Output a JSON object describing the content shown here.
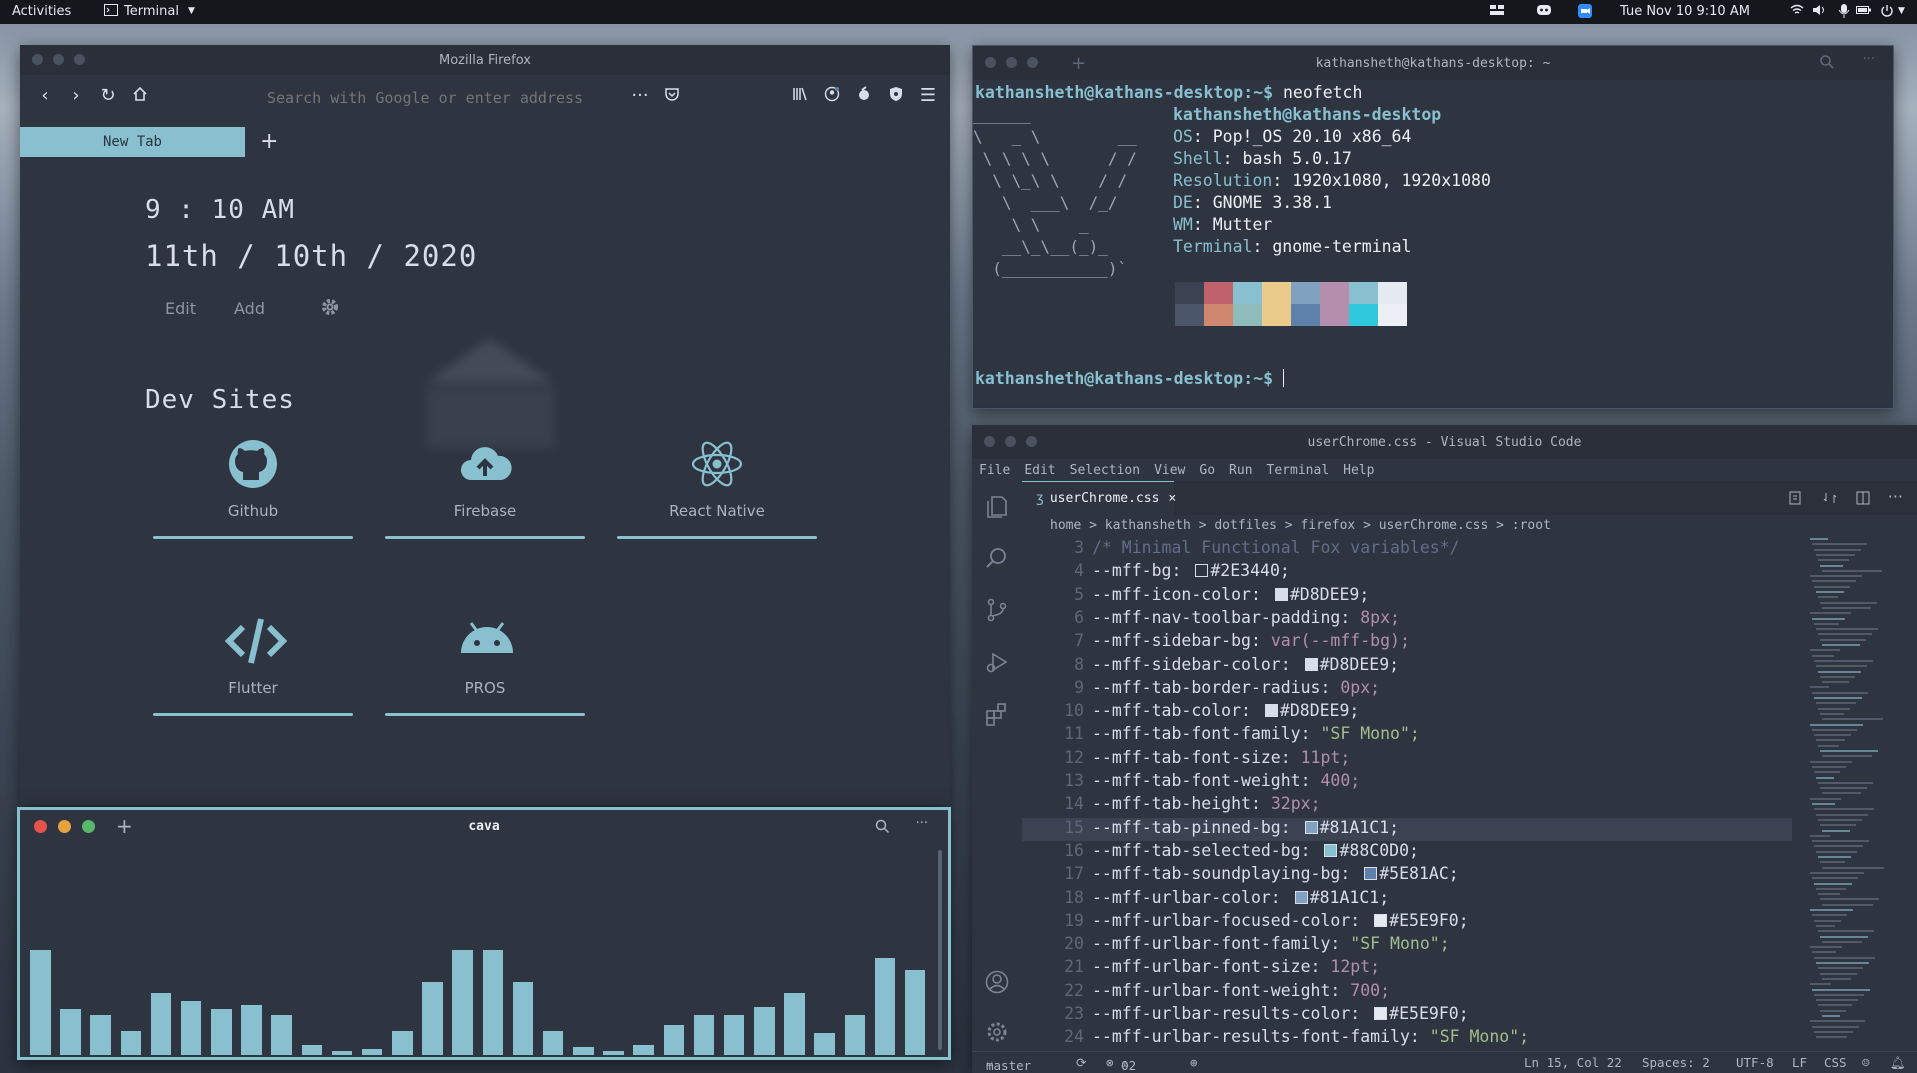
{
  "topbar": {
    "activities": "Activities",
    "app_menu": "Terminal",
    "clock": "Tue Nov 10  9:10 AM"
  },
  "firefox": {
    "title": "Mozilla Firefox",
    "url_placeholder": "Search with Google or enter address",
    "tab_label": "New Tab",
    "time_hour": "9",
    "time_rest": "10 AM",
    "date_parts": [
      "11th",
      "10th",
      "2020"
    ],
    "edit_label": "Edit",
    "add_label": "Add",
    "section_title": "Dev Sites",
    "sites": [
      {
        "label": "Github",
        "icon": "github-icon"
      },
      {
        "label": "Firebase",
        "icon": "cloud-upload-icon"
      },
      {
        "label": "React Native",
        "icon": "react-icon"
      },
      {
        "label": "Flutter",
        "icon": "code-icon"
      },
      {
        "label": "PROS",
        "icon": "android-icon"
      }
    ]
  },
  "terminal": {
    "title": "kathansheth@kathans-desktop: ~",
    "prompt": "kathansheth@kathans-desktop:~$",
    "command": "neofetch",
    "user_host": "kathansheth@kathans-desktop",
    "info": [
      {
        "key": "OS",
        "value": "Pop!_OS 20.10 x86_64"
      },
      {
        "key": "Shell",
        "value": "bash 5.0.17"
      },
      {
        "key": "Resolution",
        "value": "1920x1080, 1920x1080"
      },
      {
        "key": "DE",
        "value": "GNOME 3.38.1"
      },
      {
        "key": "WM",
        "value": "Mutter"
      },
      {
        "key": "Terminal",
        "value": "gnome-terminal"
      }
    ],
    "palette_top": [
      "#3B4252",
      "#BF616A",
      "#88C0D0",
      "#EBCB8B",
      "#81A1C1",
      "#B48EAD",
      "#88C0D0",
      "#E5E9F0"
    ],
    "palette_bottom": [
      "#4C566A",
      "#D08770",
      "#8FBCBB",
      "#EBCB8B",
      "#5E81AC",
      "#B48EAD",
      "#30C8DC",
      "#ECEFF4"
    ]
  },
  "vscode": {
    "title": "userChrome.css - Visual Studio Code",
    "menu": [
      "File",
      "Edit",
      "Selection",
      "View",
      "Go",
      "Run",
      "Terminal",
      "Help"
    ],
    "tab_label": "userChrome.css",
    "breadcrumb": "home > kathansheth > dotfiles > firefox > userChrome.css > :root",
    "lines": [
      {
        "n": "3",
        "prop": "/* Minimal Functional Fox variables*/",
        "kind": "comment"
      },
      {
        "n": "4",
        "prop": "--mff-bg:",
        "val": "#2E3440;",
        "kind": "color",
        "swatch": "#2E3440"
      },
      {
        "n": "5",
        "prop": "--mff-icon-color:",
        "val": "#D8DEE9;",
        "kind": "color",
        "swatch": "#D8DEE9"
      },
      {
        "n": "6",
        "prop": "--mff-nav-toolbar-padding:",
        "val": "8px;",
        "kind": "num"
      },
      {
        "n": "7",
        "prop": "--mff-sidebar-bg:",
        "val": "var(--mff-bg);",
        "kind": "var"
      },
      {
        "n": "8",
        "prop": "--mff-sidebar-color:",
        "val": "#D8DEE9;",
        "kind": "color",
        "swatch": "#D8DEE9"
      },
      {
        "n": "9",
        "prop": "--mff-tab-border-radius:",
        "val": "0px;",
        "kind": "num"
      },
      {
        "n": "10",
        "prop": "--mff-tab-color:",
        "val": "#D8DEE9;",
        "kind": "color",
        "swatch": "#D8DEE9"
      },
      {
        "n": "11",
        "prop": "--mff-tab-font-family:",
        "val": "\"SF Mono\";",
        "kind": "str"
      },
      {
        "n": "12",
        "prop": "--mff-tab-font-size:",
        "val": "11pt;",
        "kind": "num"
      },
      {
        "n": "13",
        "prop": "--mff-tab-font-weight:",
        "val": "400;",
        "kind": "num"
      },
      {
        "n": "14",
        "prop": "--mff-tab-height:",
        "val": "32px;",
        "kind": "num"
      },
      {
        "n": "15",
        "prop": "--mff-tab-pinned-bg:",
        "val": "#81A1C1;",
        "kind": "color",
        "swatch": "#81A1C1"
      },
      {
        "n": "16",
        "prop": "--mff-tab-selected-bg:",
        "val": "#88C0D0;",
        "kind": "color",
        "swatch": "#88C0D0"
      },
      {
        "n": "17",
        "prop": "--mff-tab-soundplaying-bg:",
        "val": "#5E81AC;",
        "kind": "color",
        "swatch": "#5E81AC"
      },
      {
        "n": "18",
        "prop": "--mff-urlbar-color:",
        "val": "#81A1C1;",
        "kind": "color",
        "swatch": "#81A1C1"
      },
      {
        "n": "19",
        "prop": "--mff-urlbar-focused-color:",
        "val": "#E5E9F0;",
        "kind": "color",
        "swatch": "#E5E9F0"
      },
      {
        "n": "20",
        "prop": "--mff-urlbar-font-family:",
        "val": "\"SF Mono\";",
        "kind": "str"
      },
      {
        "n": "21",
        "prop": "--mff-urlbar-font-size:",
        "val": "12pt;",
        "kind": "num"
      },
      {
        "n": "22",
        "prop": "--mff-urlbar-font-weight:",
        "val": "700;",
        "kind": "num"
      },
      {
        "n": "23",
        "prop": "--mff-urlbar-results-color:",
        "val": "#E5E9F0;",
        "kind": "color",
        "swatch": "#E5E9F0"
      },
      {
        "n": "24",
        "prop": "--mff-urlbar-results-font-family:",
        "val": "\"SF Mono\";",
        "kind": "str"
      }
    ],
    "status": {
      "branch": "master",
      "errors": "0",
      "warnings": "2",
      "position": "Ln 15, Col 22",
      "spaces": "Spaces: 2",
      "encoding": "UTF-8",
      "eol": "LF",
      "language": "CSS"
    }
  },
  "cava": {
    "title": "cava",
    "bar_color": "#88C0D0",
    "bar_levels": [
      0.53,
      0.23,
      0.2,
      0.12,
      0.31,
      0.27,
      0.23,
      0.25,
      0.2,
      0.05,
      0.02,
      0.03,
      0.12,
      0.37,
      0.53,
      0.53,
      0.37,
      0.12,
      0.04,
      0.02,
      0.05,
      0.15,
      0.2,
      0.2,
      0.24,
      0.31,
      0.11,
      0.2,
      0.49,
      0.43
    ]
  }
}
